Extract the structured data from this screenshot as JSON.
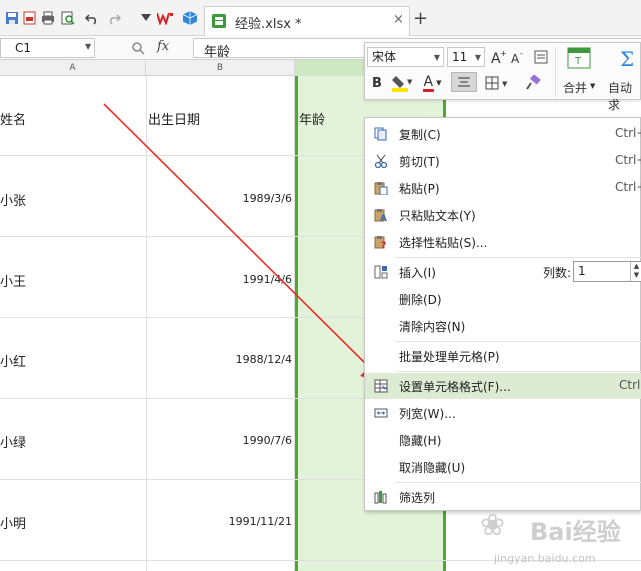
{
  "tabbar": {
    "doc_tab_label": "经验.xlsx *",
    "close_symbol": "×",
    "add_symbol": "+"
  },
  "formula_bar": {
    "cell_ref": "C1",
    "fx_label": "fx",
    "formula_value": "年龄"
  },
  "sheet": {
    "columns": [
      {
        "letter": "A"
      },
      {
        "letter": "B"
      }
    ],
    "header_row": {
      "name": "姓名",
      "birth": "出生日期",
      "age": "年龄"
    },
    "rows": [
      {
        "name": "小张",
        "birth": "1989/3/6"
      },
      {
        "name": "小王",
        "birth": "1991/4/6"
      },
      {
        "name": "小红",
        "birth": "1988/12/4"
      },
      {
        "name": "小绿",
        "birth": "1990/7/6"
      },
      {
        "name": "小明",
        "birth": "1991/11/21"
      }
    ]
  },
  "mini_toolbar": {
    "font_name": "宋体",
    "font_size": "11",
    "bold_label": "B",
    "font_color_label": "A",
    "merge_label": "合并",
    "auto_sum_label": "自动求",
    "font_color": "#d9201f",
    "fill_color": "#ffe400"
  },
  "context_menu": {
    "items": [
      {
        "label": "复制(C)",
        "shortcut": "Ctrl+",
        "icon": "copy-icon"
      },
      {
        "label": "剪切(T)",
        "shortcut": "Ctrl+",
        "icon": "scissors-icon"
      },
      {
        "label": "粘贴(P)",
        "shortcut": "Ctrl+",
        "icon": "paste-icon"
      },
      {
        "label": "只粘贴文本(Y)",
        "icon": "paste-text-icon"
      },
      {
        "label": "选择性粘贴(S)...",
        "icon": "paste-special-icon"
      },
      {
        "label": "插入(I)",
        "icon": "insert-icon"
      },
      {
        "label": "删除(D)"
      },
      {
        "label": "清除内容(N)"
      },
      {
        "label": "批量处理单元格(P)"
      },
      {
        "label": "设置单元格格式(F)...",
        "shortcut": "Ctrl-",
        "icon": "format-cells-icon"
      },
      {
        "label": "列宽(W)...",
        "icon": "column-width-icon"
      },
      {
        "label": "隐藏(H)"
      },
      {
        "label": "取消隐藏(U)"
      },
      {
        "label": "筛选列",
        "icon": "filter-column-icon"
      }
    ],
    "insert_count_label": "列数:",
    "insert_count_value": "1",
    "spin_up": "▲",
    "spin_down": "▼"
  },
  "watermark": {
    "brand": "Bai经验",
    "url": "jingyan.baidu.com"
  },
  "colors": {
    "selection_green": "#4ea72e",
    "selection_fill": "#e3f3d9",
    "arrow_red": "#e8302a",
    "menu_highlight": "#dcebd2"
  }
}
